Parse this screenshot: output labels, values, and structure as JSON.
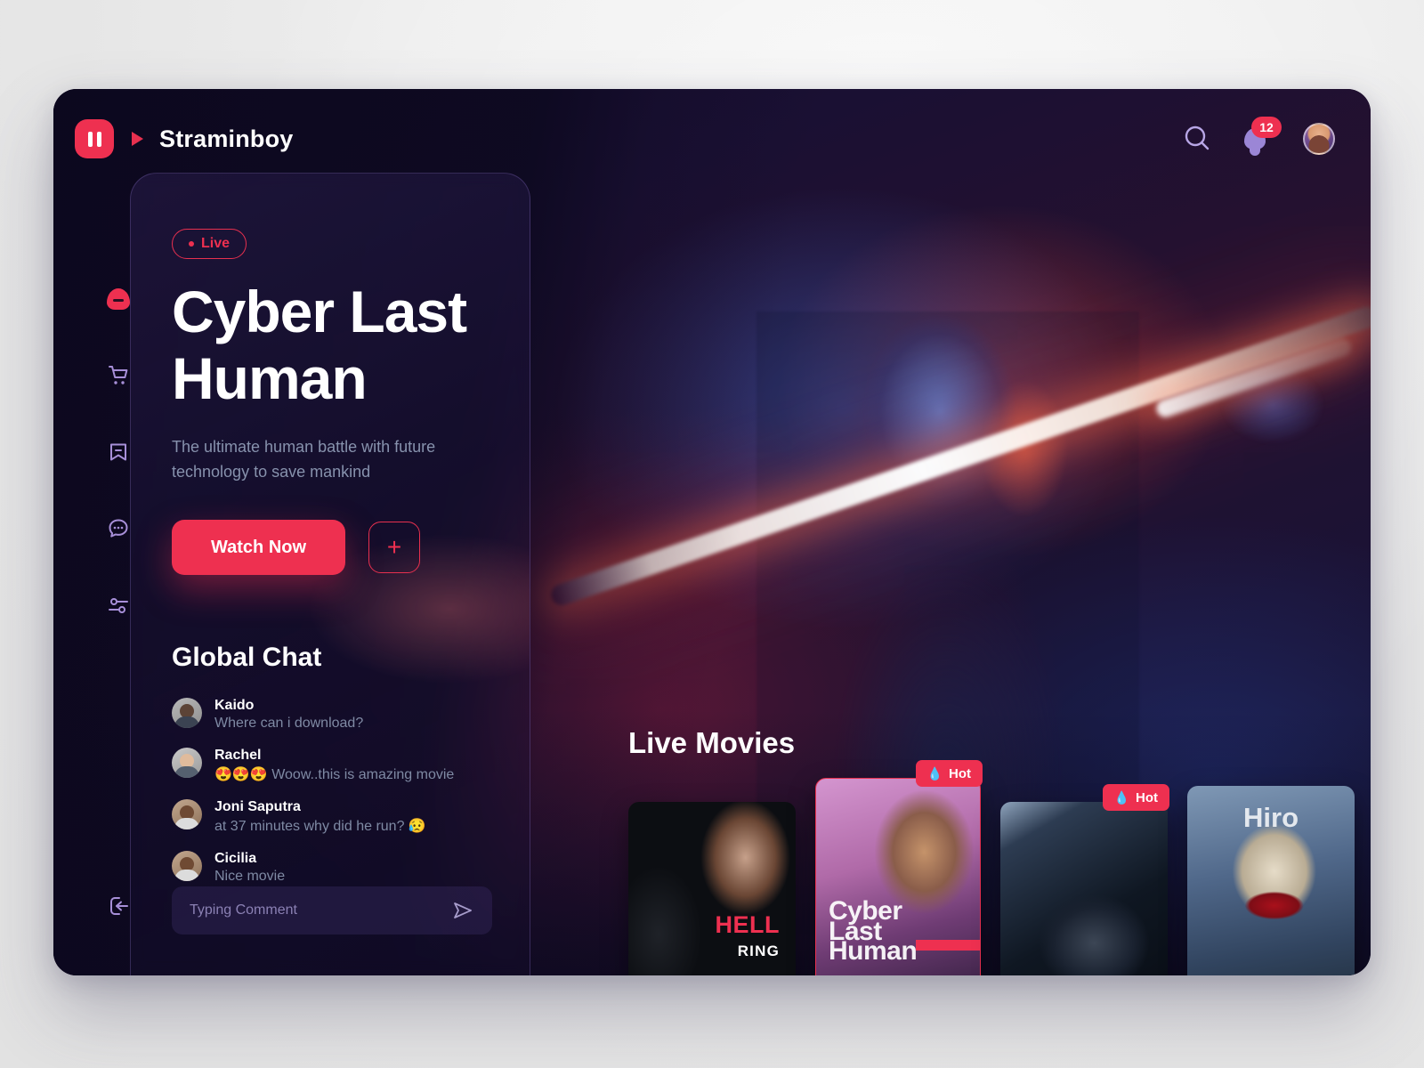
{
  "brand": {
    "name": "Straminboy",
    "logo_icon": "pause-icon",
    "play_icon": "play-icon"
  },
  "header": {
    "search_icon": "search-icon",
    "notification_icon": "bell-icon",
    "notification_count": "12",
    "avatar": "user-avatar"
  },
  "sidebar": {
    "items": [
      {
        "icon": "home-icon",
        "active": true
      },
      {
        "icon": "cart-icon",
        "active": false
      },
      {
        "icon": "bookmark-icon",
        "active": false
      },
      {
        "icon": "chat-icon",
        "active": false
      },
      {
        "icon": "sliders-icon",
        "active": false
      }
    ],
    "logout_icon": "logout-icon"
  },
  "hero": {
    "live_label": "Live",
    "title_line1": "Cyber Last",
    "title_line2": "Human",
    "description": "The ultimate human battle with future technology to save mankind",
    "watch_label": "Watch Now",
    "add_label": "+"
  },
  "chat": {
    "title": "Global Chat",
    "messages": [
      {
        "name": "Kaido",
        "text": "Where can i download?"
      },
      {
        "name": "Rachel",
        "text": "😍😍😍 Woow..this is amazing movie"
      },
      {
        "name": "Joni Saputra",
        "text": "at 37 minutes why did he run? 😥"
      },
      {
        "name": "Cicilia",
        "text": "Nice movie"
      }
    ],
    "input_placeholder": "Typing Comment",
    "send_icon": "send-icon"
  },
  "movies": {
    "title": "Live Movies",
    "hot_label": "Hot",
    "hot_icon": "flame-icon",
    "cards": [
      {
        "title_primary": "HELL",
        "title_secondary": "RING",
        "hot": false
      },
      {
        "title_line1": "Cyber",
        "title_line2": "Last",
        "title_line3": "Human",
        "hot": true
      },
      {
        "title": "",
        "hot": true
      },
      {
        "title": "Hiro",
        "hot": false
      }
    ]
  },
  "colors": {
    "accent": "#ee3050",
    "background": "#0f0a23",
    "page": "#ececec",
    "muted_text": "#7f8aa4"
  }
}
